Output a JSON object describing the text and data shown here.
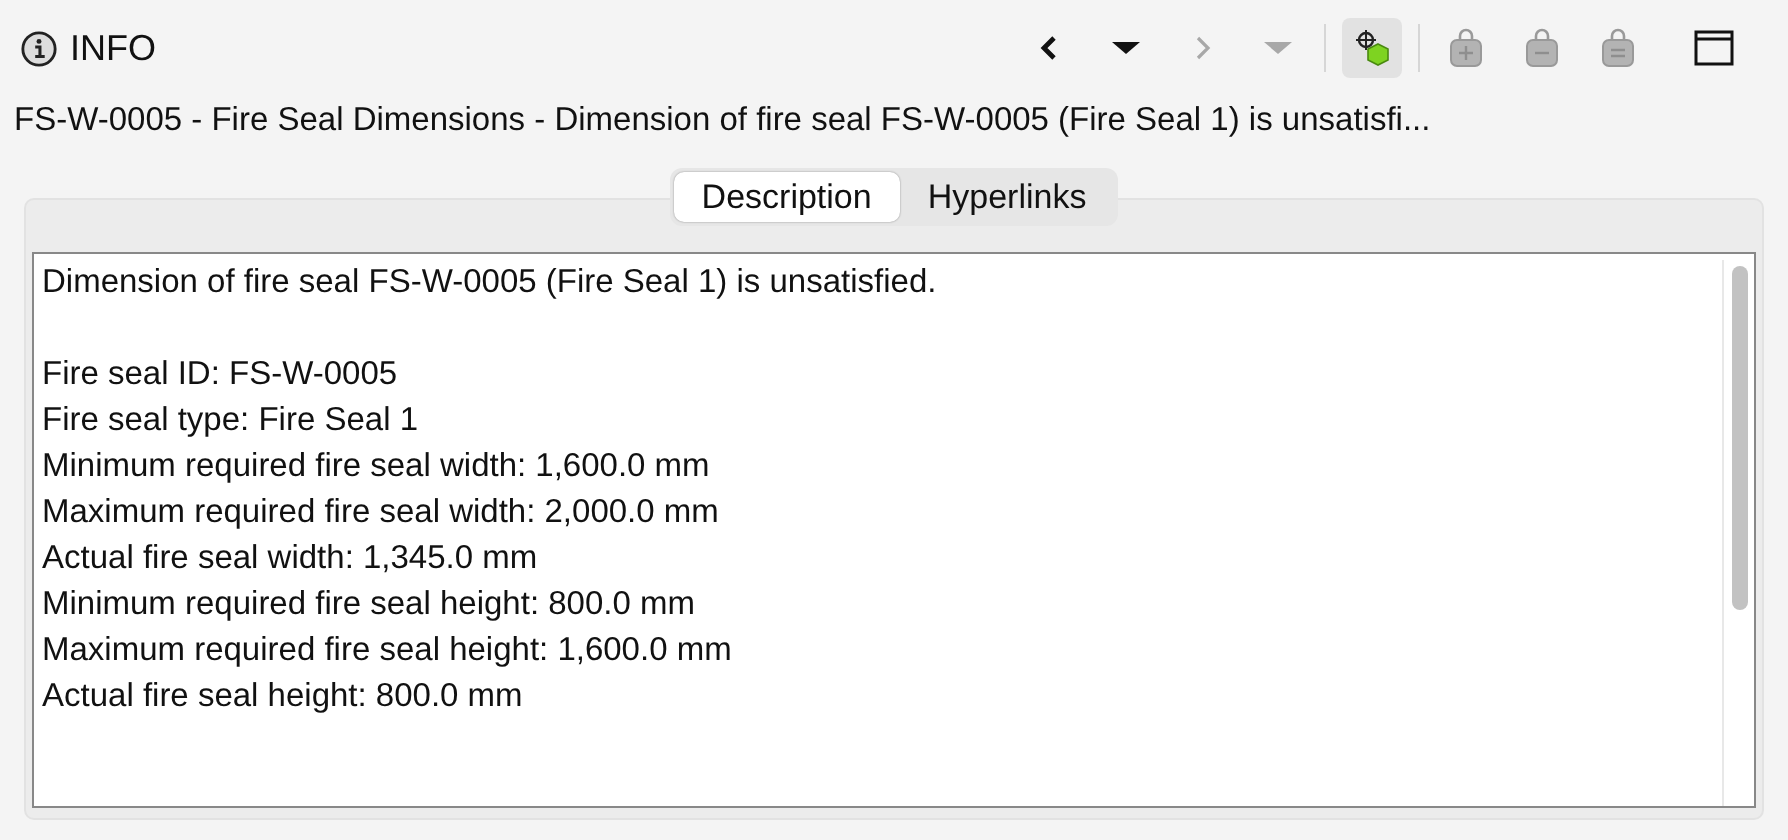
{
  "header": {
    "title": "INFO"
  },
  "toolbar": [
    {
      "kind": "back",
      "disabled": false
    },
    {
      "kind": "dropdown",
      "disabled": false
    },
    {
      "kind": "forward",
      "disabled": true
    },
    {
      "kind": "dropdown",
      "disabled": true
    },
    {
      "kind": "separator"
    },
    {
      "kind": "model",
      "disabled": false,
      "selected": true
    },
    {
      "kind": "separator"
    },
    {
      "kind": "add",
      "disabled": true
    },
    {
      "kind": "remove",
      "disabled": true
    },
    {
      "kind": "equal",
      "disabled": true
    },
    {
      "kind": "window"
    }
  ],
  "subject": "FS-W-0005 - Fire Seal Dimensions - Dimension of fire seal FS-W-0005 (Fire Seal 1) is unsatisfi...",
  "tabs": [
    {
      "label": "Description",
      "selected": true
    },
    {
      "label": "Hyperlinks",
      "selected": false
    }
  ],
  "description": {
    "summary": "Dimension of fire seal FS-W-0005 (Fire Seal 1) is unsatisfied.",
    "details": [
      "Fire seal ID: FS-W-0005",
      "Fire seal type: Fire Seal 1",
      "Minimum required fire seal width: 1,600.0 mm",
      "Maximum required fire seal width: 2,000.0 mm",
      "Actual fire seal width: 1,345.0 mm",
      "Minimum required fire seal height: 800.0 mm",
      "Maximum required fire seal height: 1,600.0 mm",
      "Actual fire seal height: 800.0 mm"
    ]
  }
}
